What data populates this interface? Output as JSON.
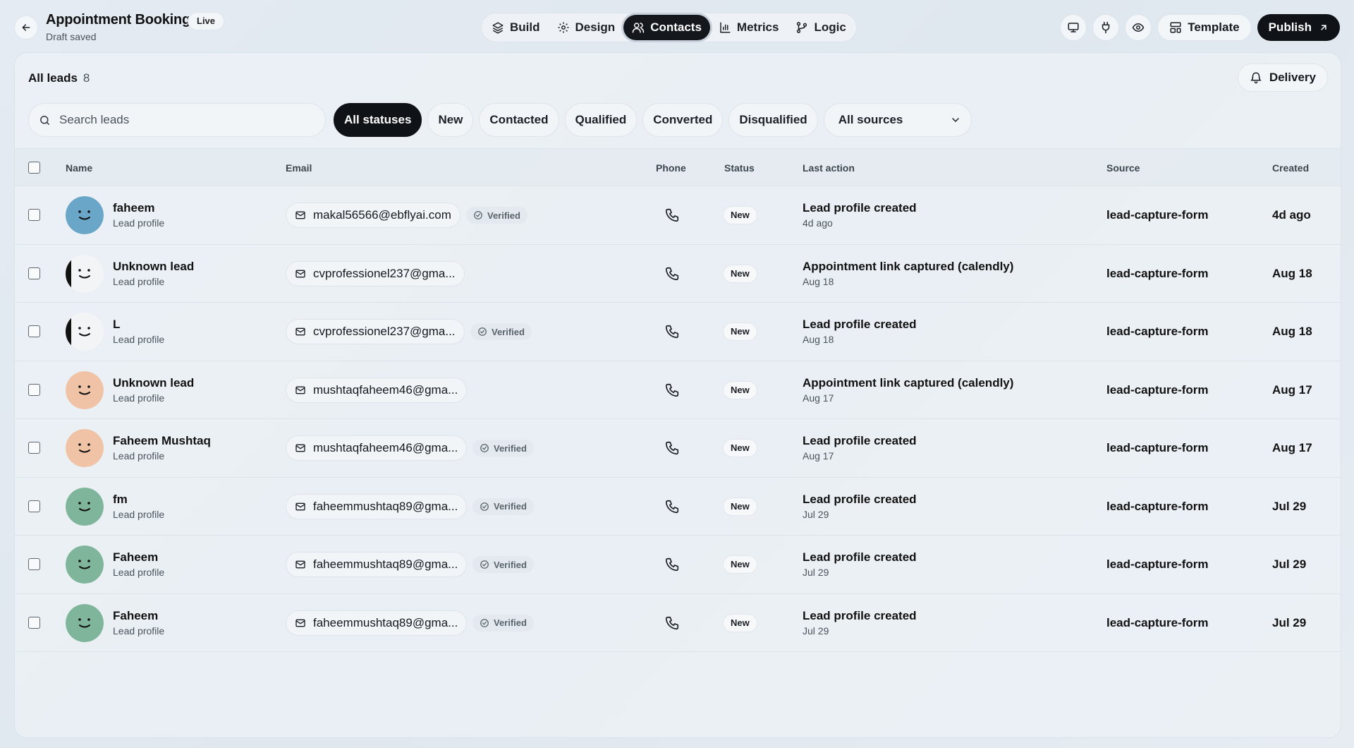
{
  "header": {
    "back_icon": "arrow-left-icon",
    "title": "Appointment Booking",
    "live_badge": "Live",
    "draft_status": "Draft saved",
    "nav": [
      {
        "label": "Build",
        "icon": "layers-icon"
      },
      {
        "label": "Design",
        "icon": "gear-icon"
      },
      {
        "label": "Contacts",
        "icon": "users-icon",
        "active": true
      },
      {
        "label": "Metrics",
        "icon": "bar-chart-icon"
      },
      {
        "label": "Logic",
        "icon": "branch-icon"
      }
    ],
    "tools": [
      "monitor-icon",
      "plug-icon",
      "eye-icon"
    ],
    "template_label": "Template",
    "publish_label": "Publish"
  },
  "leads": {
    "title": "All leads",
    "count": "8",
    "delivery_label": "Delivery",
    "search_placeholder": "Search leads",
    "filters": [
      "All statuses",
      "New",
      "Contacted",
      "Qualified",
      "Converted",
      "Disqualified"
    ],
    "active_filter": "All statuses",
    "source_select": "All sources"
  },
  "table": {
    "columns": {
      "name": "Name",
      "email": "Email",
      "phone": "Phone",
      "status": "Status",
      "last_action": "Last action",
      "source": "Source",
      "created": "Created"
    },
    "rows": [
      {
        "name": "faheem",
        "sub": "Lead profile",
        "email": "makal56566@ebflyai.com",
        "verified": "Verified",
        "status": "New",
        "last_action": "Lead profile created",
        "last_time": "4d ago",
        "source": "lead-capture-form",
        "created": "4d ago",
        "avatar_color": "#6aa6c8"
      },
      {
        "name": "Unknown lead",
        "sub": "Lead profile",
        "email": "cvprofessionel237@gma...",
        "verified": "",
        "status": "New",
        "last_action": "Appointment link captured (calendly)",
        "last_time": "Aug 18",
        "source": "lead-capture-form",
        "created": "Aug 18",
        "avatar_color": "#f3f4f6"
      },
      {
        "name": "L",
        "sub": "Lead profile",
        "email": "cvprofessionel237@gma...",
        "verified": "Verified",
        "status": "New",
        "last_action": "Lead profile created",
        "last_time": "Aug 18",
        "source": "lead-capture-form",
        "created": "Aug 18",
        "avatar_color": "#f3f4f6"
      },
      {
        "name": "Unknown lead",
        "sub": "Lead profile",
        "email": "mushtaqfaheem46@gma...",
        "verified": "",
        "status": "New",
        "last_action": "Appointment link captured (calendly)",
        "last_time": "Aug 17",
        "source": "lead-capture-form",
        "created": "Aug 17",
        "avatar_color": "#f0c3a6"
      },
      {
        "name": "Faheem Mushtaq",
        "sub": "Lead profile",
        "email": "mushtaqfaheem46@gma...",
        "verified": "Verified",
        "status": "New",
        "last_action": "Lead profile created",
        "last_time": "Aug 17",
        "source": "lead-capture-form",
        "created": "Aug 17",
        "avatar_color": "#f0c3a6"
      },
      {
        "name": "fm",
        "sub": "Lead profile",
        "email": "faheemmushtaq89@gma...",
        "verified": "Verified",
        "status": "New",
        "last_action": "Lead profile created",
        "last_time": "Jul 29",
        "source": "lead-capture-form",
        "created": "Jul 29",
        "avatar_color": "#7fb59a"
      },
      {
        "name": "Faheem",
        "sub": "Lead profile",
        "email": "faheemmushtaq89@gma...",
        "verified": "Verified",
        "status": "New",
        "last_action": "Lead profile created",
        "last_time": "Jul 29",
        "source": "lead-capture-form",
        "created": "Jul 29",
        "avatar_color": "#7fb59a"
      },
      {
        "name": "Faheem",
        "sub": "Lead profile",
        "email": "faheemmushtaq89@gma...",
        "verified": "Verified",
        "status": "New",
        "last_action": "Lead profile created",
        "last_time": "Jul 29",
        "source": "lead-capture-form",
        "created": "Jul 29",
        "avatar_color": "#7fb59a"
      }
    ]
  }
}
